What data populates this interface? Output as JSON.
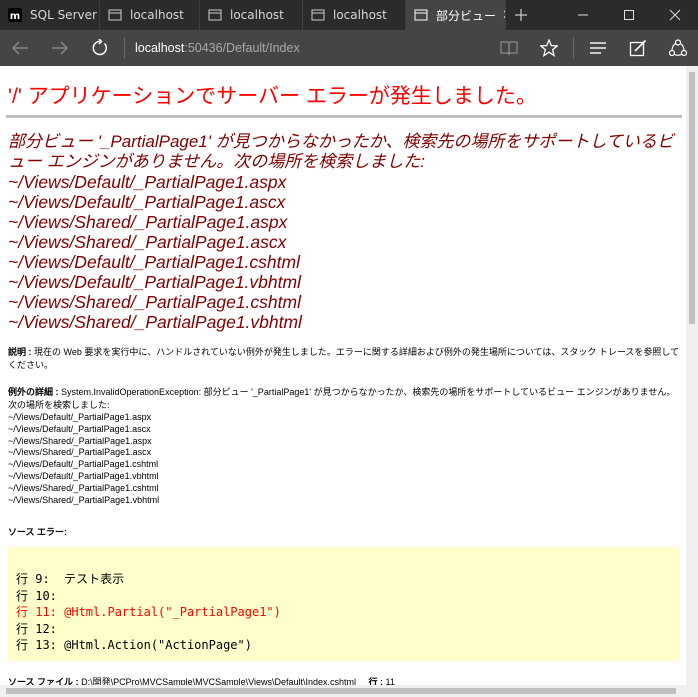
{
  "tabs": [
    {
      "title": "SQL Server M",
      "favicon": "sql-server-icon",
      "active": false
    },
    {
      "title": "localhost",
      "favicon": "page-icon",
      "active": false
    },
    {
      "title": "localhost",
      "favicon": "page-icon",
      "active": false
    },
    {
      "title": "localhost",
      "favicon": "page-icon",
      "active": false
    },
    {
      "title": "部分ビュー",
      "favicon": "page-icon",
      "active": true
    }
  ],
  "address": {
    "host": "localhost",
    "rest": ":50436/Default/Index"
  },
  "page": {
    "title": "'/' アプリケーションでサーバー エラーが発生しました。",
    "message": "部分ビュー '_PartialPage1' が見つからなかったか、検索先の場所をサポートしているビュー エンジンがありません。次の場所を検索しました:",
    "paths": [
      "~/Views/Default/_PartialPage1.aspx",
      "~/Views/Default/_PartialPage1.ascx",
      "~/Views/Shared/_PartialPage1.aspx",
      "~/Views/Shared/_PartialPage1.ascx",
      "~/Views/Default/_PartialPage1.cshtml",
      "~/Views/Default/_PartialPage1.vbhtml",
      "~/Views/Shared/_PartialPage1.cshtml",
      "~/Views/Shared/_PartialPage1.vbhtml"
    ],
    "description_label": "説明 :",
    "description": "現在の Web 要求を実行中に、ハンドルされていない例外が発生しました。エラーに関する詳細および例外の発生場所については、スタック トレースを参照してください。",
    "exception_label": "例外の詳細 :",
    "exception": "System.InvalidOperationException: 部分ビュー '_PartialPage1' が見つからなかったか、検索先の場所をサポートしているビュー エンジンがありません。次の場所を検索しました:",
    "source_error_label": "ソース エラー:",
    "code_lines": [
      {
        "text": "行 9:  テスト表示",
        "highlight": false
      },
      {
        "text": "行 10:",
        "highlight": false
      },
      {
        "text": "行 11: @Html.Partial(\"_PartialPage1\")",
        "highlight": true
      },
      {
        "text": "行 12:",
        "highlight": false
      },
      {
        "text": "行 13: @Html.Action(\"ActionPage\")",
        "highlight": false
      }
    ],
    "source_file_label": "ソース ファイル :",
    "source_file": "D:\\開発\\PCPro\\MVCSample\\MVCSample\\Views\\Default\\Index.cshtml",
    "line_label": "行 :",
    "line_number": "11"
  },
  "colors": {
    "error_title": "#ff0000",
    "error_message": "#800000",
    "code_bg": "#ffffcc",
    "code_highlight": "#ff0000"
  }
}
